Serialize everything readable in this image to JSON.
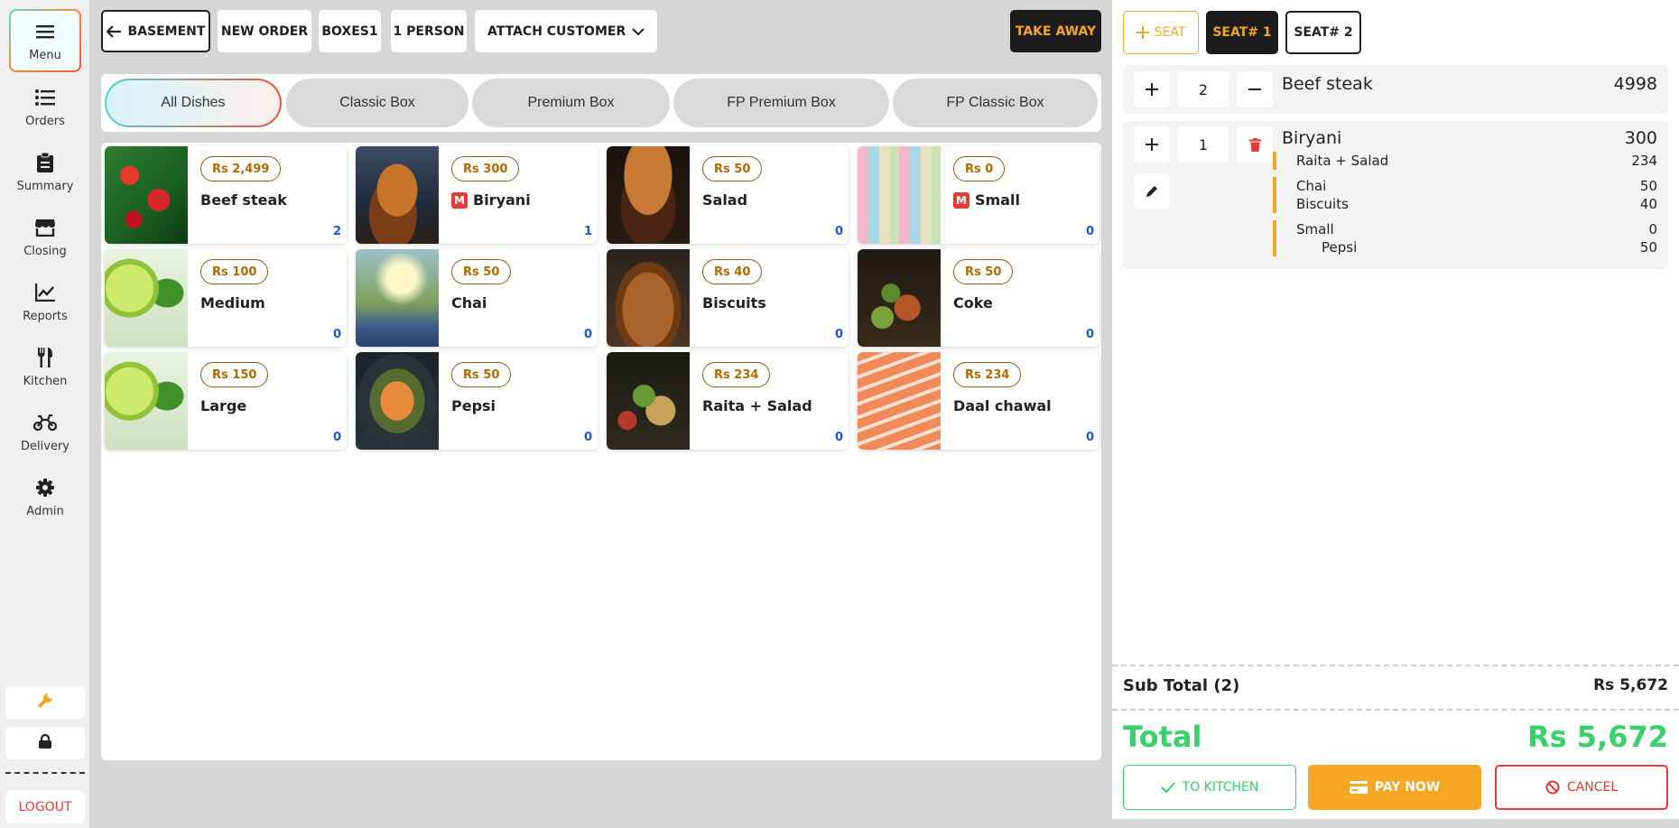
{
  "sidebar": {
    "items": [
      {
        "label": "Menu",
        "icon": "hamburger-menu-icon"
      },
      {
        "label": "Orders",
        "icon": "list-icon"
      },
      {
        "label": "Summary",
        "icon": "clipboard-icon"
      },
      {
        "label": "Closing",
        "icon": "store-icon"
      },
      {
        "label": "Reports",
        "icon": "line-chart-icon"
      },
      {
        "label": "Kitchen",
        "icon": "utensils-icon"
      },
      {
        "label": "Delivery",
        "icon": "motorcycle-icon"
      },
      {
        "label": "Admin",
        "icon": "gear-icon"
      }
    ],
    "logout_label": "LOGOUT"
  },
  "topbar": {
    "back_label": "BASEMENT",
    "new_order_label": "NEW ORDER",
    "boxes_label": "BOXES1",
    "person_label": "1 PERSON",
    "attach_customer_label": "ATTACH CUSTOMER",
    "take_away_label": "TAKE AWAY"
  },
  "tabs": [
    "All Dishes",
    "Classic Box",
    "Premium Box",
    "FP Premium Box",
    "FP Classic Box"
  ],
  "dishes": [
    {
      "price": "Rs 2,499",
      "name": "Beef steak",
      "count": "2",
      "m": false
    },
    {
      "price": "Rs 300",
      "name": "Biryani",
      "count": "1",
      "m": true
    },
    {
      "price": "Rs 50",
      "name": "Salad",
      "count": "0",
      "m": false
    },
    {
      "price": "Rs 0",
      "name": "Small",
      "count": "0",
      "m": true
    },
    {
      "price": "Rs 100",
      "name": "Medium",
      "count": "0",
      "m": false
    },
    {
      "price": "Rs 50",
      "name": "Chai",
      "count": "0",
      "m": false
    },
    {
      "price": "Rs 40",
      "name": "Biscuits",
      "count": "0",
      "m": false
    },
    {
      "price": "Rs 50",
      "name": "Coke",
      "count": "0",
      "m": false
    },
    {
      "price": "Rs 150",
      "name": "Large",
      "count": "0",
      "m": false
    },
    {
      "price": "Rs 50",
      "name": "Pepsi",
      "count": "0",
      "m": false
    },
    {
      "price": "Rs 234",
      "name": "Raita + Salad",
      "count": "0",
      "m": false
    },
    {
      "price": "Rs 234",
      "name": "Daal chawal",
      "count": "0",
      "m": false
    }
  ],
  "mark_letter": "M",
  "seats": {
    "add_label": "SEAT",
    "seat1_label": "SEAT# 1",
    "seat2_label": "SEAT# 2"
  },
  "order": {
    "item1": {
      "qty": "2",
      "name": "Beef steak",
      "price": "4998"
    },
    "item2": {
      "qty": "1",
      "name": "Biryani",
      "price": "300",
      "subs": [
        {
          "name": "Raita + Salad",
          "price": "234"
        },
        {
          "name": "Chai",
          "price": "50"
        },
        {
          "name": "Biscuits",
          "price": "40"
        },
        {
          "name": "Small",
          "price": "0"
        },
        {
          "name": "Pepsi",
          "price": "50"
        }
      ]
    }
  },
  "summary": {
    "subtotal_label": "Sub Total (2)",
    "subtotal_value": "Rs 5,672",
    "total_label": "Total",
    "total_value": "Rs 5,672"
  },
  "actions": {
    "to_kitchen": "TO KITCHEN",
    "pay_now": "PAY NOW",
    "cancel": "CANCEL"
  },
  "colors": {
    "accent_orange": "#f5a623",
    "total_green": "#3ad06b",
    "danger_red": "#e53935",
    "count_blue": "#1a56d6"
  }
}
